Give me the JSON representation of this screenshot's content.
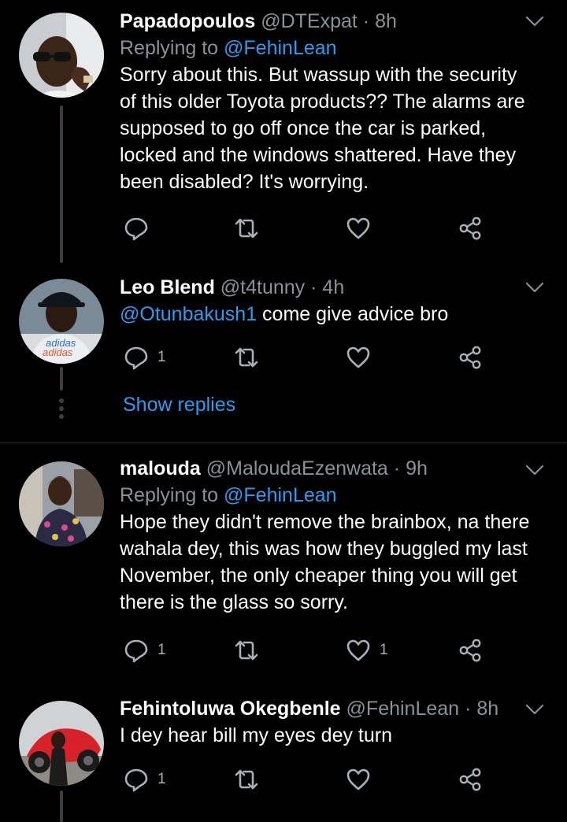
{
  "tweets": [
    {
      "name": "Papadopoulos",
      "handle": "@DTExpat",
      "time": "8h",
      "reply_label": "Replying to",
      "reply_to": "@FehinLean",
      "text": "Sorry about this. But wassup with the security of this older Toyota products?? The alarms are supposed to go off once the car is parked, locked and the windows shattered. Have they been disabled? It's worrying.",
      "reply_count": "",
      "like_count": ""
    },
    {
      "name": "Leo Blend",
      "handle": "@t4tunny",
      "time": "4h",
      "mention": "@Otunbakush1",
      "text": " come give advice bro",
      "reply_count": "1",
      "like_count": "",
      "show_replies": "Show replies"
    },
    {
      "name": "malouda",
      "handle": "@MaloudaEzenwata",
      "time": "9h",
      "reply_label": "Replying to",
      "reply_to": "@FehinLean",
      "text": "Hope they didn't remove the brainbox, na there wahala dey, this  was how they buggled my last November, the only cheaper thing you will get there is the glass so sorry.",
      "reply_count": "1",
      "like_count": "1"
    },
    {
      "name": "Fehintoluwa Okegbenle",
      "handle": "@FehinLean",
      "time": "8h",
      "text": "I dey hear bill my eyes dey turn",
      "reply_count": "1",
      "like_count": ""
    }
  ],
  "separator": "·",
  "icons": [
    "reply-icon",
    "retweet-icon",
    "like-icon",
    "share-icon",
    "chevron-down-icon"
  ],
  "colors": {
    "background": "#000000",
    "accent": "#2a9df0",
    "muted": "#8a9199",
    "text": "#ffffff"
  }
}
